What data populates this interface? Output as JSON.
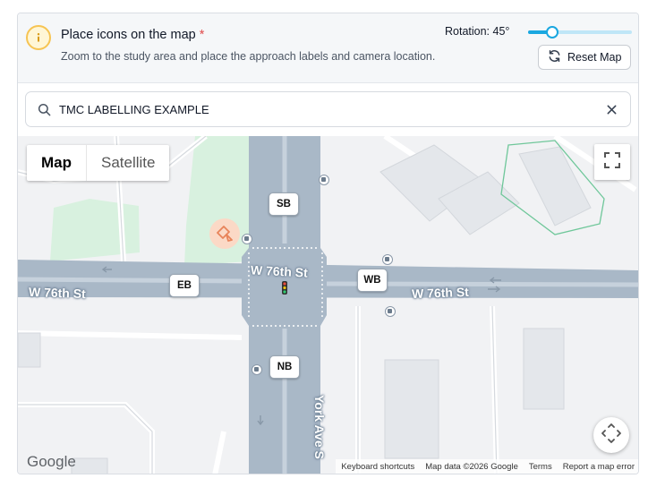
{
  "header": {
    "title": "Place icons on the map",
    "required_marker": "*",
    "subtitle": "Zoom to the study area and place the approach labels and camera location.",
    "info_icon": "info-icon"
  },
  "rotation": {
    "label": "Rotation: 45°",
    "value_degrees": 45,
    "max_degrees": 360
  },
  "reset_button": {
    "label": "Reset Map",
    "icon": "refresh-icon"
  },
  "search": {
    "value": "TMC LABELLING EXAMPLE",
    "icon": "search-icon",
    "clear_icon": "close-icon"
  },
  "map": {
    "map_type": [
      "Map",
      "Satellite"
    ],
    "selected_map_type": "Map",
    "approach_labels": [
      "SB",
      "EB",
      "WB",
      "NB"
    ],
    "camera_icon": "camera-icon",
    "streets": [
      "W 76th St",
      "W 76th St",
      "W 76th St",
      "York Ave S"
    ],
    "provider_logo": "Google",
    "attribution": [
      "Keyboard shortcuts",
      "Map data ©2026 Google",
      "Terms",
      "Report a map error"
    ],
    "fullscreen_icon": "fullscreen-icon",
    "pan_icon": "pan-control-icon"
  },
  "colors": {
    "accent": "#1aa7e0",
    "required": "#e04b4b",
    "camera": "#e8845a",
    "road": "#a9b8c7",
    "park": "#dff3e6"
  }
}
